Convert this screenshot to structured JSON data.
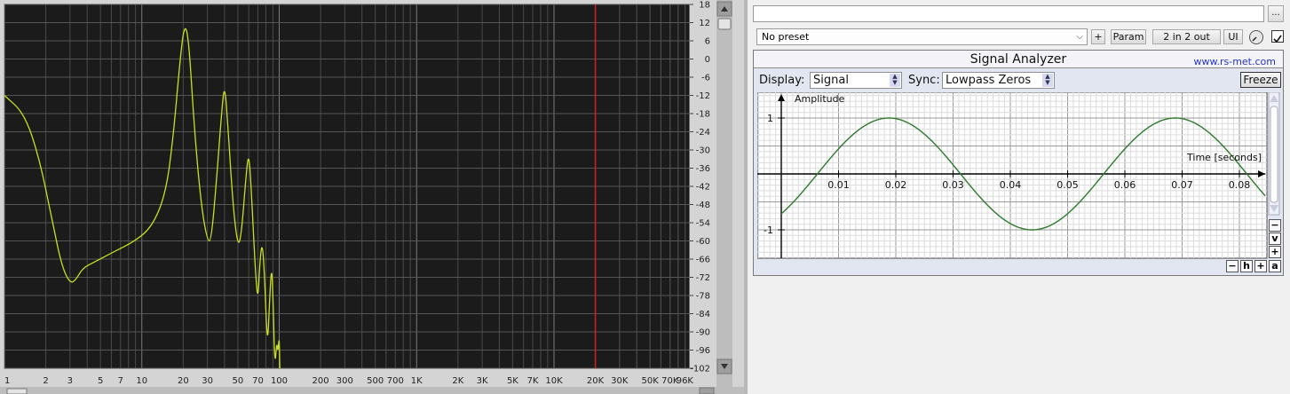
{
  "spectrum": {
    "db_labels": [
      "18",
      "12",
      "6",
      "0",
      "-6",
      "-12",
      "-18",
      "-24",
      "-30",
      "-36",
      "-42",
      "-48",
      "-54",
      "-60",
      "-66",
      "-72",
      "-78",
      "-84",
      "-90",
      "-96",
      "-102"
    ],
    "freq_labels": [
      {
        "hz": 1,
        "label": "1"
      },
      {
        "hz": 2,
        "label": "2"
      },
      {
        "hz": 3,
        "label": "3"
      },
      {
        "hz": 5,
        "label": "5"
      },
      {
        "hz": 7,
        "label": "7"
      },
      {
        "hz": 10,
        "label": "10"
      },
      {
        "hz": 20,
        "label": "20"
      },
      {
        "hz": 30,
        "label": "30"
      },
      {
        "hz": 50,
        "label": "50"
      },
      {
        "hz": 70,
        "label": "70"
      },
      {
        "hz": 100,
        "label": "100"
      },
      {
        "hz": 200,
        "label": "200"
      },
      {
        "hz": 300,
        "label": "300"
      },
      {
        "hz": 500,
        "label": "500"
      },
      {
        "hz": 700,
        "label": "700"
      },
      {
        "hz": 1000,
        "label": "1K"
      },
      {
        "hz": 2000,
        "label": "2K"
      },
      {
        "hz": 3000,
        "label": "3K"
      },
      {
        "hz": 5000,
        "label": "5K"
      },
      {
        "hz": 7000,
        "label": "7K"
      },
      {
        "hz": 10000,
        "label": "10K"
      },
      {
        "hz": 20000,
        "label": "20K"
      },
      {
        "hz": 30000,
        "label": "30K"
      },
      {
        "hz": 50000,
        "label": "50K"
      },
      {
        "hz": 70000,
        "label": "70K"
      },
      {
        "hz": 96000,
        "label": "96K"
      }
    ],
    "marker_hz": 20000,
    "curve_color": "#c8e020",
    "curve": [
      [
        1,
        -12
      ],
      [
        1.4,
        -18
      ],
      [
        1.8,
        -33
      ],
      [
        2.2,
        -52
      ],
      [
        2.6,
        -68
      ],
      [
        3,
        -74
      ],
      [
        3.3,
        -73
      ],
      [
        3.7,
        -69
      ],
      [
        4.5,
        -67
      ],
      [
        6,
        -64
      ],
      [
        9,
        -60
      ],
      [
        12,
        -55
      ],
      [
        15,
        -44
      ],
      [
        17,
        -25
      ],
      [
        19,
        0
      ],
      [
        20.5,
        12
      ],
      [
        22,
        6
      ],
      [
        24,
        -22
      ],
      [
        27,
        -48
      ],
      [
        30,
        -60
      ],
      [
        32,
        -60
      ],
      [
        35,
        -40
      ],
      [
        38,
        -18
      ],
      [
        40,
        -8
      ],
      [
        42,
        -20
      ],
      [
        46,
        -48
      ],
      [
        50,
        -62
      ],
      [
        53,
        -58
      ],
      [
        57,
        -40
      ],
      [
        60,
        -30
      ],
      [
        63,
        -45
      ],
      [
        67,
        -70
      ],
      [
        70,
        -80
      ],
      [
        72,
        -68
      ],
      [
        75,
        -60
      ],
      [
        78,
        -70
      ],
      [
        82,
        -96
      ],
      [
        85,
        -80
      ],
      [
        88,
        -68
      ],
      [
        90,
        -78
      ],
      [
        93,
        -102
      ],
      [
        96,
        -93
      ],
      [
        98,
        -97
      ],
      [
        100,
        -91
      ],
      [
        101,
        -102
      ]
    ]
  },
  "plugin": {
    "preset_input": "",
    "more_button": "...",
    "preset": "No preset",
    "add_button": "+",
    "param_button": "Param",
    "routing_button": "2 in 2 out",
    "ui_button": "UI",
    "knob_icon": "knob-icon",
    "enabled": true
  },
  "analyzer": {
    "title": "Signal Analyzer",
    "link": "www.rs-met.com",
    "display_label": "Display:",
    "display_value": "Signal",
    "sync_label": "Sync:",
    "sync_value": "Lowpass Zeros",
    "freeze_button": "Freeze",
    "y_axis_label": "Amplitude",
    "x_axis_label": "Time [seconds]",
    "x_ticks": [
      "0.01",
      "0.02",
      "0.03",
      "0.04",
      "0.05",
      "0.06",
      "0.07",
      "0.08"
    ],
    "y_ticks": [
      "1",
      "-1"
    ],
    "signal_frequency_hz": 20,
    "signal_phase_offset_s": 0.0063,
    "signal_color": "#2e7a2e",
    "zoom_buttons": {
      "v_minus": "−",
      "v": "v",
      "v_plus": "+",
      "h_minus": "−",
      "h": "h",
      "h_plus": "+",
      "a": "a"
    }
  }
}
